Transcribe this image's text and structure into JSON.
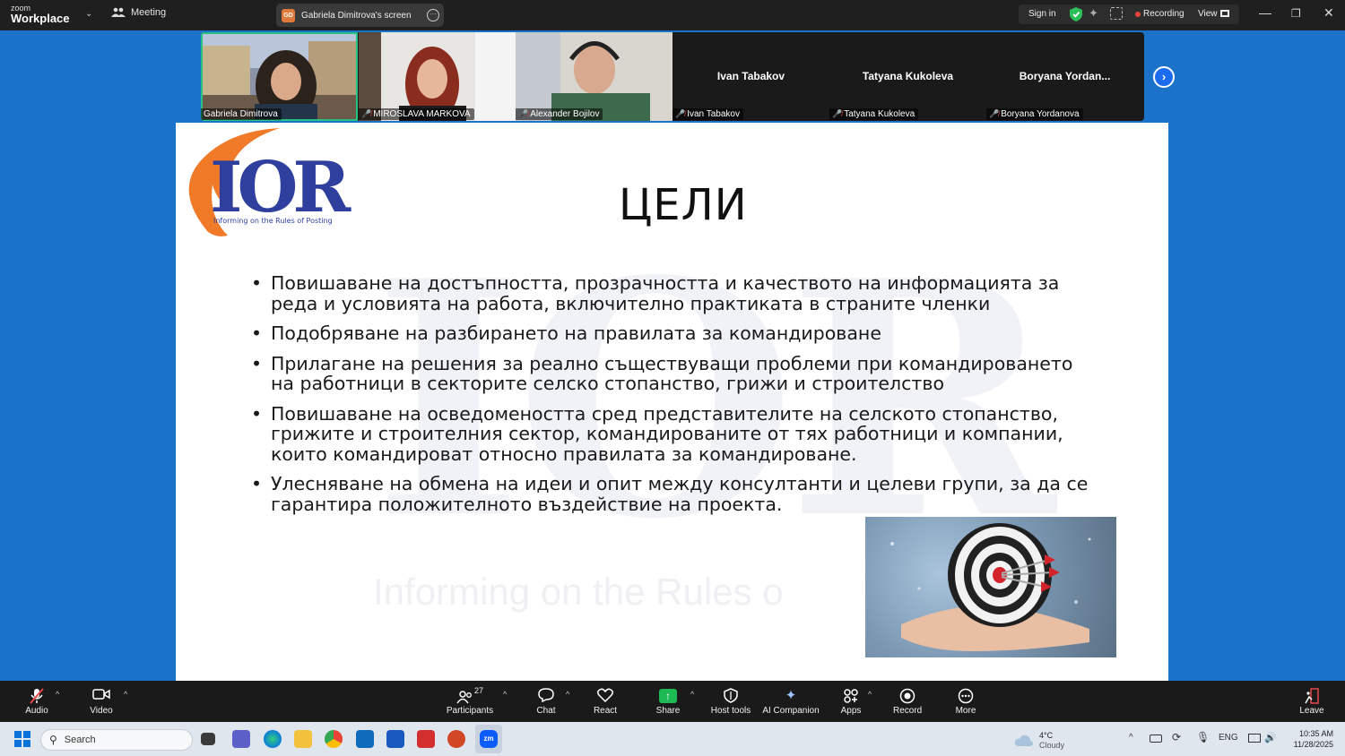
{
  "topbar": {
    "logo_line1": "zoom",
    "logo_line2": "Workplace",
    "meeting_label": "Meeting",
    "share_badge": "GD",
    "share_label": "Gabriela Dimitrova's screen",
    "sign_in": "Sign in",
    "recording_label": "Recording",
    "view_label": "View",
    "minimize": "—",
    "restore": "❐",
    "close": "✕"
  },
  "gallery": {
    "tiles": [
      {
        "name": "Gabriela Dimitrova",
        "muted": false,
        "video": true
      },
      {
        "name": "MIROSLAVA MARKOVA",
        "muted": true,
        "video": true
      },
      {
        "name": "Alexander Bojilov",
        "muted": true,
        "video": true
      },
      {
        "name": "Ivan Tabakov",
        "display": "Ivan Tabakov",
        "muted": true,
        "video": false
      },
      {
        "name": "Tatyana Kukoleva",
        "display": "Tatyana Kukoleva",
        "muted": true,
        "video": false
      },
      {
        "name": "Boryana Yordanova",
        "display": "Boryana  Yordan...",
        "muted": true,
        "video": false
      }
    ]
  },
  "slide": {
    "logo_subtitle": "Informing on the Rules of Posting",
    "watermark_text": "Informing on the Rules o",
    "title": "ЦЕЛИ",
    "bullets": [
      "Повишаване на достъпността, прозрачността и качеството на информацията за реда и условията на работа, включително практиката в страните членки",
      "Подобряване на разбирането на правилата за командироване",
      "Прилагане на решения за реално съществуващи проблеми при командироването на работници в секторите селско стопанство, грижи и строителство",
      "Повишаване на осведомеността сред представителите на селското стопанство, грижите и строителния сектор, командированите от тях работници и компании, които командироват относно правилата за командироване.",
      "Улесняване на обмена на идеи и опит между консултанти и целеви групи, за да се гарантира положителното въздействие на проекта."
    ]
  },
  "controls": {
    "audio": "Audio",
    "video": "Video",
    "participants": "Participants",
    "participants_count": "27",
    "chat": "Chat",
    "react": "React",
    "share": "Share",
    "host_tools": "Host tools",
    "ai_companion": "AI Companion",
    "apps": "Apps",
    "record": "Record",
    "more": "More",
    "leave": "Leave"
  },
  "taskbar": {
    "search_placeholder": "Search",
    "weather_temp": "4°C",
    "weather_cond": "Cloudy",
    "language": "ENG",
    "time": "10:35 AM",
    "date": "11/28/2025"
  },
  "colors": {
    "active_speaker": "#26c281",
    "recording": "#e2443a",
    "share_green": "#1db954",
    "logo_blue": "#2e3f9e",
    "logo_orange": "#f07a28"
  }
}
